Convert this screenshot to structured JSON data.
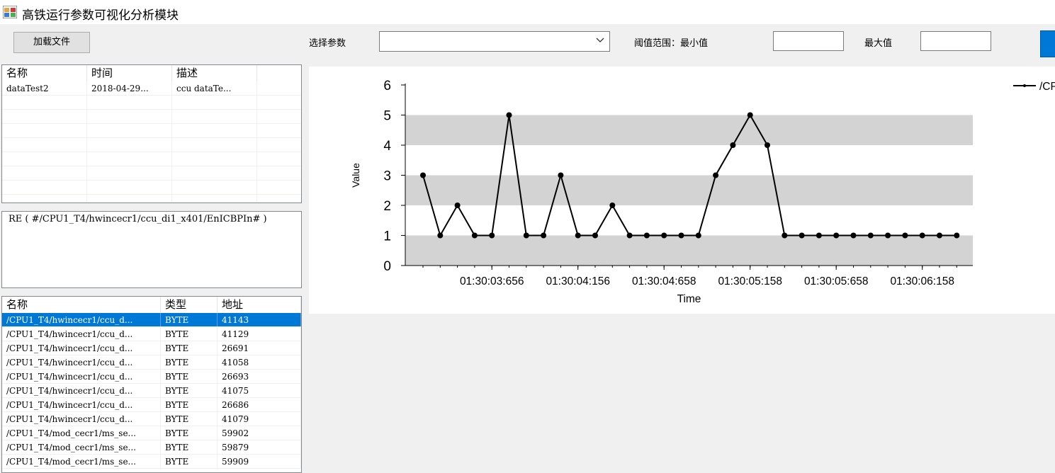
{
  "window": {
    "title": "高铁运行参数可视化分析模块"
  },
  "toolbar": {
    "load_button": "加载文件",
    "param_label": "选择参数",
    "param_value": "",
    "threshold_label": "阈值范围：最小值",
    "min_value": "",
    "max_label": "最大值",
    "max_value": ""
  },
  "files_table": {
    "columns": [
      "名称",
      "时间",
      "描述"
    ],
    "rows": [
      [
        "dataTest2",
        "2018-04-29...",
        "ccu dataTe..."
      ]
    ]
  },
  "expression": "RE ( #/CPU1_T4/hwincecr1/ccu_di1_x401/EnICBPIn# )",
  "signals_table": {
    "columns": [
      "名称",
      "类型",
      "地址"
    ],
    "rows": [
      [
        "/CPU1_T4/hwincecr1/ccu_d...",
        "BYTE",
        "41143"
      ],
      [
        "/CPU1_T4/hwincecr1/ccu_d...",
        "BYTE",
        "41129"
      ],
      [
        "/CPU1_T4/hwincecr1/ccu_d...",
        "BYTE",
        "26691"
      ],
      [
        "/CPU1_T4/hwincecr1/ccu_d...",
        "BYTE",
        "41058"
      ],
      [
        "/CPU1_T4/hwincecr1/ccu_d...",
        "BYTE",
        "26693"
      ],
      [
        "/CPU1_T4/hwincecr1/ccu_d...",
        "BYTE",
        "41075"
      ],
      [
        "/CPU1_T4/hwincecr1/ccu_d...",
        "BYTE",
        "26686"
      ],
      [
        "/CPU1_T4/hwincecr1/ccu_d...",
        "BYTE",
        "41079"
      ],
      [
        "/CPU1_T4/mod_cecr1/ms_se...",
        "BYTE",
        "59902"
      ],
      [
        "/CPU1_T4/mod_cecr1/ms_se...",
        "BYTE",
        "59879"
      ],
      [
        "/CPU1_T4/mod_cecr1/ms_se...",
        "BYTE",
        "59909"
      ]
    ],
    "selected_index": 0
  },
  "chart_data": {
    "type": "line",
    "xlabel": "Time",
    "ylabel": "Value",
    "ylim": [
      0,
      6
    ],
    "yticks": [
      0,
      1,
      2,
      3,
      4,
      5,
      6
    ],
    "x_tick_labels": [
      "01:30:03:656",
      "01:30:04:156",
      "01:30:04:658",
      "01:30:05:158",
      "01:30:05:658",
      "01:30:06:158"
    ],
    "x_tick_indices": [
      4,
      9,
      14,
      19,
      24,
      29
    ],
    "grid": "alternating horizontal bands",
    "legend_position": "top-right",
    "series": [
      {
        "name": "/CP",
        "values": [
          3,
          1,
          2,
          1,
          1,
          5,
          1,
          1,
          3,
          1,
          1,
          2,
          1,
          1,
          1,
          1,
          1,
          3,
          4,
          5,
          4,
          1,
          1,
          1,
          1,
          1,
          1,
          1,
          1,
          1,
          1,
          1
        ]
      }
    ]
  }
}
